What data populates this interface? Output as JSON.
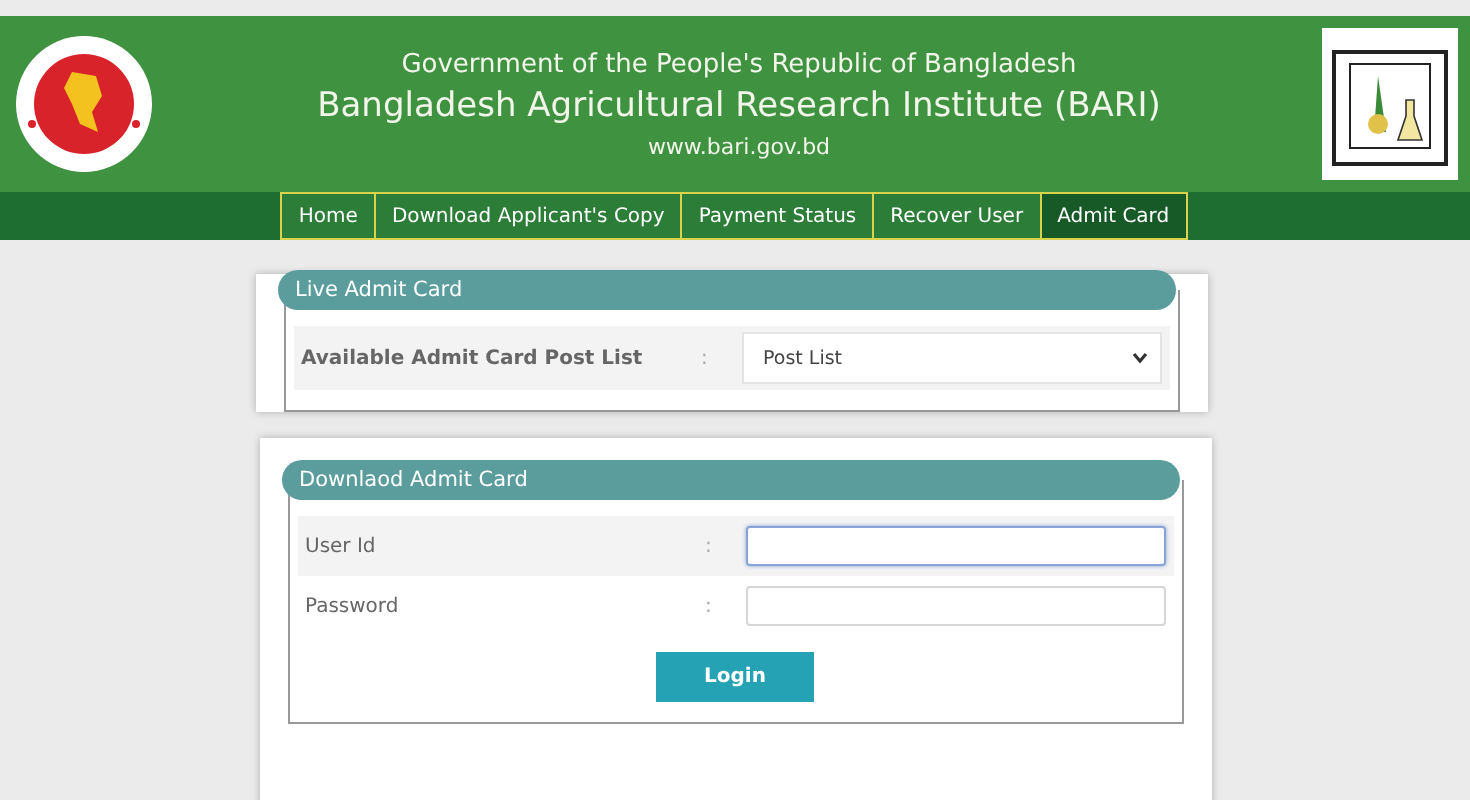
{
  "header": {
    "government": "Government of the People's Republic of Bangladesh",
    "institute": "Bangladesh Agricultural Research Institute (BARI)",
    "website": "www.bari.gov.bd"
  },
  "nav": [
    {
      "label": "Home",
      "selected": false
    },
    {
      "label": "Download Applicant's Copy",
      "selected": false
    },
    {
      "label": "Payment Status",
      "selected": false
    },
    {
      "label": "Recover User",
      "selected": false
    },
    {
      "label": "Admit Card",
      "selected": true
    }
  ],
  "live_card": {
    "title": "Live Admit Card",
    "label": "Available Admit Card Post List",
    "separator": ":",
    "select_value": "Post List"
  },
  "download_card": {
    "title": "Downlaod Admit Card",
    "fields": [
      {
        "label": "User Id",
        "separator": ":",
        "focused": true
      },
      {
        "label": "Password",
        "separator": ":",
        "focused": false
      }
    ],
    "button": "Login"
  }
}
